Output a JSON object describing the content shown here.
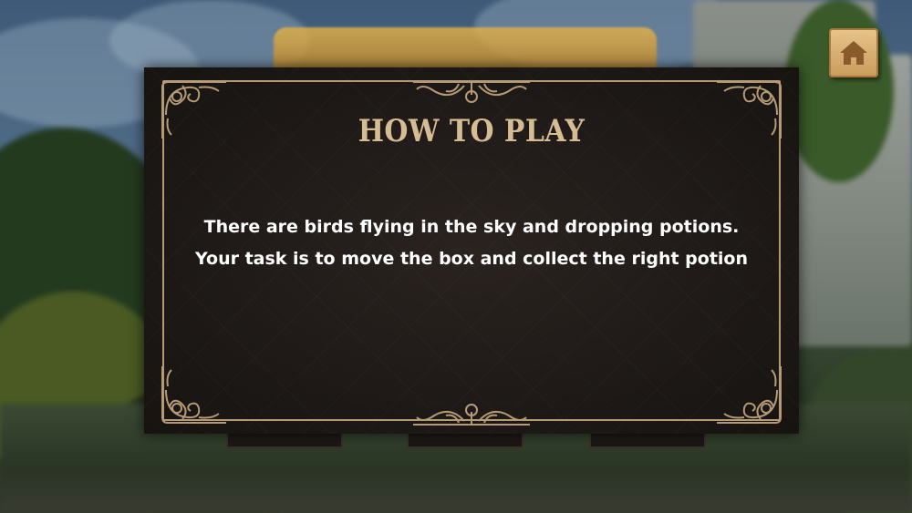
{
  "panel": {
    "title": "HOW TO PLAY",
    "instructions": [
      "There are birds flying in the sky and dropping potions.",
      "Your task is to move the box and collect the right potion"
    ]
  },
  "home_button": {
    "icon": "home-icon"
  },
  "colors": {
    "panel_background": "#1c1816",
    "title": "#d6bc93",
    "border": "#b59a76",
    "text": "#ffffff",
    "home_button": "#d9ae72"
  }
}
